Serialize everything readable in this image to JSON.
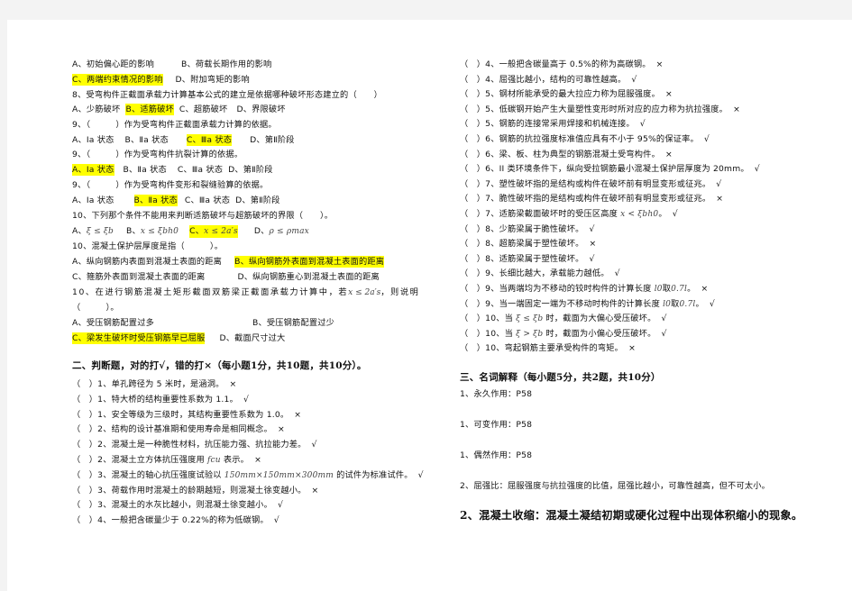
{
  "left": {
    "q_prev_options": {
      "a": "A、初始偏心距的影响",
      "b": "B、荷载长期作用的影响",
      "c": "C、两端约束情况的影响",
      "d": "D、附加弯矩的影响"
    },
    "q8": {
      "stem": "8、受弯构件正截面承载力计算基本公式的建立是依据哪种破坏形态建立的（　　）",
      "a": "A、少筋破坏",
      "b": "B、适筋破坏",
      "c": "C、超筋破坏",
      "d": "D、界限破坏"
    },
    "q9a": {
      "stem": "9、（　　　）作为受弯构件正截面承载力计算的依据。",
      "a": "A、Ⅰa 状态",
      "b": "B、Ⅱa 状态",
      "c": "C、Ⅲa 状态",
      "d": "D、第Ⅱ阶段"
    },
    "q9b": {
      "stem": "9、（　　　）作为受弯构件抗裂计算的依据。",
      "a": "A、Ⅰa 状态",
      "b": "B、Ⅱa 状态",
      "c": "C、Ⅲa 状态",
      "d": "D、第Ⅱ阶段"
    },
    "q9c": {
      "stem": "9、（　　　）作为受弯构件变形和裂缝验算的依据。",
      "a": "A、Ⅰa 状态",
      "b": "B、Ⅱa 状态",
      "c": "C、Ⅲa 状态",
      "d": "D、第Ⅱ阶段"
    },
    "q10a": {
      "stem": "10、下列那个条件不能用来判断适筋破坏与超筋破坏的界限（　　）。",
      "a_label": "A、",
      "a_math": "ξ ≤ ξb",
      "b_label": "B、",
      "b_math": "x ≤ ξbh0",
      "c_label": "C、",
      "c_math": "x ≤ 2a′s",
      "d_label": "D、",
      "d_math": "ρ ≤ ρmax"
    },
    "q10b": {
      "stem": "10、混凝土保护层厚度是指（　　　）。",
      "a": "A、纵向钢筋内表面到混凝土表面的距离",
      "b": "B、纵向钢筋外表面到混凝土表面的距离",
      "c": "C、箍筋外表面到混凝土表面的距离",
      "d": "D、纵向钢筋重心到混凝土表面的距离"
    },
    "q10c": {
      "stem_part1": "10、在进行钢筋混凝土矩形截面双筋梁正截面承载力计算中，若",
      "stem_math": "x ≤ 2a′s",
      "stem_part2": "，则说明",
      "stem_line2": "（　　　）。",
      "a": "A、受压钢筋配置过多",
      "b": "B、受压钢筋配置过少",
      "c": "C、梁发生破坏时受压钢筋早已屈服",
      "d": "D、截面尺寸过大"
    },
    "section2_heading": "二、判断题，对的打√，错的打×（每小题1分，共10题，共10分）。",
    "judgments": [
      {
        "text": "（　）1、单孔跨径为 5 米时，是涵洞。",
        "mark": "×"
      },
      {
        "text": "（　）1、特大桥的结构重要性系数为 1.1。",
        "mark": "√"
      },
      {
        "text": "（　）1、安全等级为三级时，其结构重要性系数为 1.0。",
        "mark": "×"
      },
      {
        "text": "（　）2、结构的设计基准期和使用寿命是相同概念。",
        "mark": "×"
      },
      {
        "text": "（　）2、混凝土是一种脆性材料，抗压能力强、抗拉能力差。",
        "mark": "√"
      },
      {
        "text_before": "（　）2、混凝土立方体抗压强度用 ",
        "math": "fcu",
        "text_after": " 表示。",
        "mark": "×"
      },
      {
        "text_before": "（　）3、混凝土的轴心抗压强度试验以 ",
        "math": "150mm×150mm×300mm",
        "text_after": " 的试件为标准试件。",
        "mark": "√"
      },
      {
        "text": "（　）3、荷载作用时混凝土的龄期越短，则混凝土徐变越小。",
        "mark": "×"
      },
      {
        "text": "（　）3、混凝土的水灰比越小，则混凝土徐变越小。",
        "mark": "√"
      },
      {
        "text": "（　）4、一般把含碳量少于 0.22%的称为低碳钢。",
        "mark": "√"
      }
    ]
  },
  "right": {
    "judgments": [
      {
        "text": "（　）4、一般把含碳量高于 0.5%的称为高碳钢。",
        "mark": "×"
      },
      {
        "text": "（　）4、屈强比越小，结构的可靠性越高。",
        "mark": "√"
      },
      {
        "text": "（　）5、钢材所能承受的最大拉应力称为屈服强度。",
        "mark": "×"
      },
      {
        "text": "（　）5、低碳钢开始产生大量塑性变形时所对应的应力称为抗拉强度。",
        "mark": "×"
      },
      {
        "text": "（　）5、钢筋的连接常采用焊接和机械连接。",
        "mark": "√"
      },
      {
        "text": "（　）6、钢筋的抗拉强度标准值应具有不小于 95%的保证率。",
        "mark": "√"
      },
      {
        "text": "（　）6、梁、板、柱为典型的钢筋混凝土受弯构件。",
        "mark": "×"
      },
      {
        "text": "（　）6、II 类环境条件下，纵向受拉钢筋最小混凝土保护层厚度为 20mm。",
        "mark": "√"
      },
      {
        "text": "（　）7、塑性破坏指的是结构或构件在破坏前有明显变形或征兆。",
        "mark": "√"
      },
      {
        "text": "（　）7、脆性破坏指的是结构或构件在破坏前有明显变形或征兆。",
        "mark": "×"
      },
      {
        "text_before": "（　）7、适筋梁截面破坏时的受压区高度 ",
        "math": "x < ξbh0",
        "text_after": "。",
        "mark": "√"
      },
      {
        "text": "（　）8、少筋梁属于脆性破坏。",
        "mark": "√"
      },
      {
        "text": "（　）8、超筋梁属于塑性破坏。",
        "mark": "×"
      },
      {
        "text": "（　）8、适筋梁属于塑性破坏。",
        "mark": "√"
      },
      {
        "text": "（　）9、长细比越大，承载能力越低。",
        "mark": "√"
      },
      {
        "text_before": "（　）9、当两端均为不移动的铰时构件的计算长度 ",
        "math": "l0",
        "text_mid": "取",
        "math2": "0.7l",
        "text_after": "。",
        "mark": "×"
      },
      {
        "text_before": "（　）9、当一端固定一端为不移动时构件的计算长度 ",
        "math": "l0",
        "text_mid": "取",
        "math2": "0.7l",
        "text_after": "。",
        "mark": "√"
      },
      {
        "text_before": "（　）10、当 ",
        "math": "ξ ≤ ξb",
        "text_after": " 时，截面为大偏心受压破坏。",
        "mark": "√"
      },
      {
        "text_before": "（　）10、当 ",
        "math": "ξ > ξb",
        "text_after": " 时，截面为小偏心受压破坏。",
        "mark": "√"
      },
      {
        "text": "（　）10、弯起钢筋主要承受构件的弯矩。",
        "mark": "×"
      }
    ],
    "section3_heading": "三、名词解释（每小题5分，共2题，共10分）",
    "terms": [
      "1、永久作用：P58",
      "1、可变作用：P58",
      "1、偶然作用：P58",
      "2、屈强比：屈服强度与抗拉强度的比值，屈强比越小，可靠性越高，但不可太小。"
    ],
    "final_answer": "2、混凝土收缩：混凝土凝结初期或硬化过程中出现体积缩小的现象。"
  }
}
